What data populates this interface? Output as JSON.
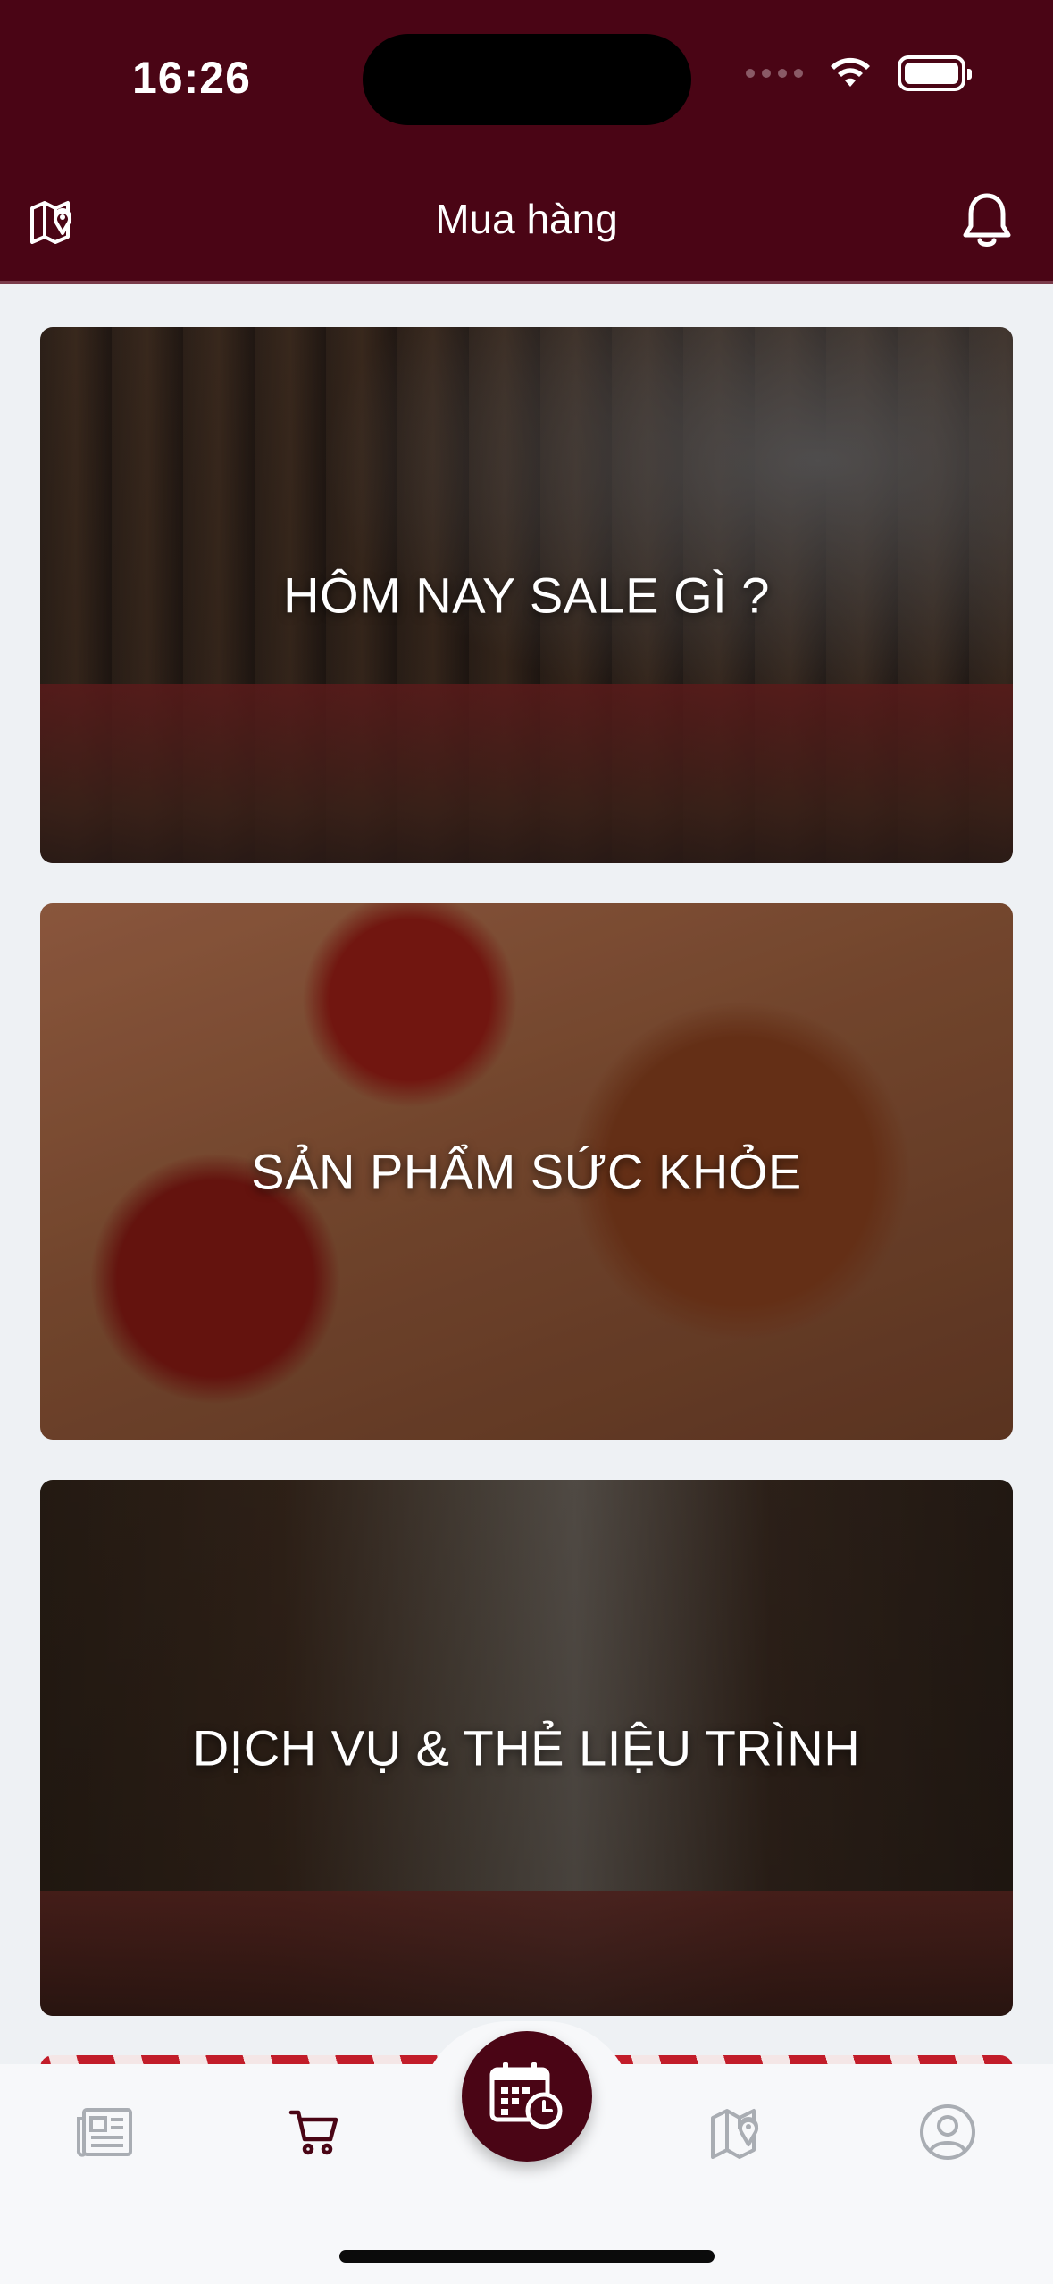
{
  "status_bar": {
    "time": "16:26"
  },
  "header": {
    "title": "Mua hàng",
    "left_icon": "map-pin-icon",
    "right_icon": "bell-icon"
  },
  "cards": [
    {
      "label": "HÔM NAY SALE GÌ ?"
    },
    {
      "label": "SẢN PHẨM SỨC KHỎE"
    },
    {
      "label": "DỊCH VỤ & THẺ LIỆU TRÌNH"
    }
  ],
  "bottom_nav": {
    "items": [
      "news-icon",
      "cart-icon",
      "calendar-clock-icon",
      "map-pin-icon",
      "user-icon"
    ],
    "active": "cart-icon"
  },
  "colors": {
    "brand": "#4a0515",
    "inactive_icon": "#a9adb3",
    "active_icon": "#4a0515"
  }
}
